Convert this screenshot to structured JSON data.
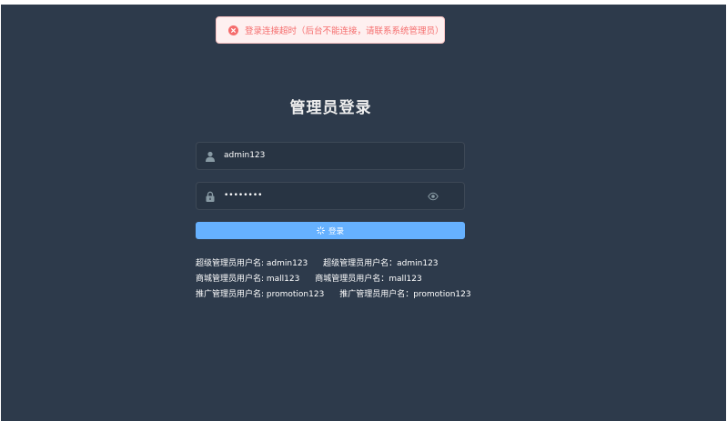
{
  "toast": {
    "icon": "error-circle-icon",
    "message": "登录连接超时（后台不能连接，请联系系统管理员）",
    "color": "#f56c6c"
  },
  "login": {
    "title": "管理员登录",
    "username": {
      "icon": "user-icon",
      "value": "admin123"
    },
    "password": {
      "icon": "lock-icon",
      "value": "••••••••",
      "toggle_icon": "eye-icon"
    },
    "submit": {
      "icon": "loading-icon",
      "label": "登录",
      "color": "#66b1ff"
    }
  },
  "tips": [
    {
      "left": "超级管理员用户名: admin123",
      "right": "超级管理员用户名：admin123"
    },
    {
      "left": "商城管理员用户名: mall123",
      "right": "商城管理员用户名：mall123"
    },
    {
      "left": "推广管理员用户名: promotion123",
      "right": "推广管理员用户名：promotion123"
    }
  ],
  "theme": {
    "background": "#2d3a4b",
    "field_background": "#283443"
  }
}
